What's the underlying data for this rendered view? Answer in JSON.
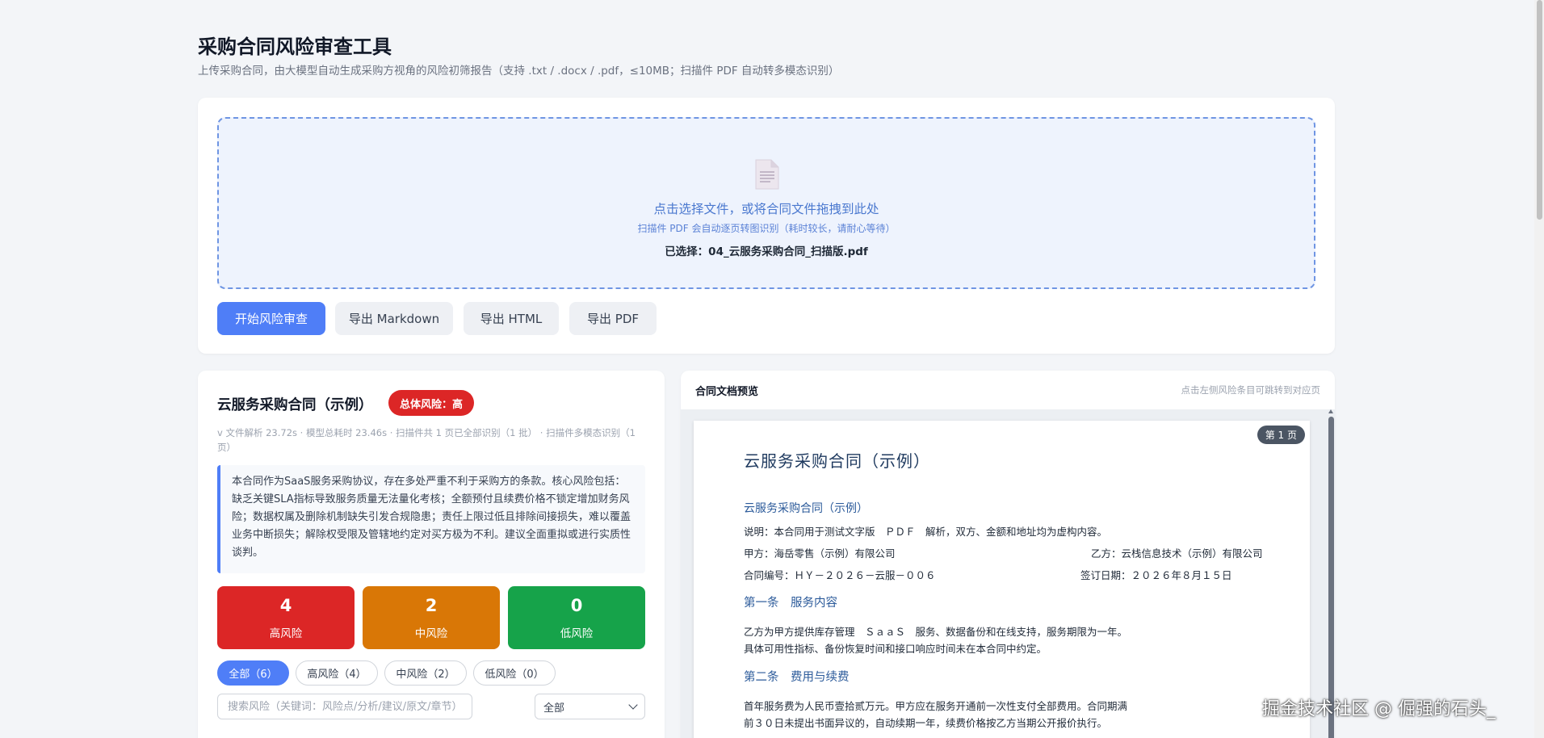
{
  "app": {
    "title": "采购合同风险审查工具",
    "subtitle": "上传采购合同，由大模型自动生成采购方视角的风险初筛报告（支持 .txt / .docx / .pdf，≤10MB；扫描件 PDF 自动转多模态识别）"
  },
  "upload": {
    "main_text": "点击选择文件，或将合同文件拖拽到此处",
    "hint_text": "扫描件 PDF 会自动逐页转图识别（耗时较长，请耐心等待）",
    "selected_text": "已选择：04_云服务采购合同_扫描版.pdf"
  },
  "toolbar": {
    "start_label": "开始风险审查",
    "export_md_label": "导出 Markdown",
    "export_html_label": "导出 HTML",
    "export_pdf_label": "导出 PDF"
  },
  "report": {
    "title": "云服务采购合同（示例）",
    "overall_risk": "总体风险：高",
    "meta": "v 文件解析 23.72s · 模型总耗时 23.46s · 扫描件共 1 页已全部识别（1 批） · 扫描件多模态识别（1 页）",
    "summary": "本合同作为SaaS服务采购协议，存在多处严重不利于采购方的条款。核心风险包括：缺乏关键SLA指标导致服务质量无法量化考核；全额预付且续费价格不锁定增加财务风险；数据权属及删除机制缺失引发合规隐患；责任上限过低且排除间接损失，难以覆盖业务中断损失；解除权受限及管辖地约定对买方极为不利。建议全面重拟或进行实质性谈判。",
    "stats": {
      "high_count": "4",
      "high_label": "高风险",
      "mid_count": "2",
      "mid_label": "中风险",
      "low_count": "0",
      "low_label": "低风险"
    },
    "filters": {
      "all": "全部（6）",
      "high": "高风险（4）",
      "mid": "中风险（2）",
      "low": "低风险（0）"
    },
    "search_placeholder": "搜索风险（关键词：风险点/分析/建议/原文/章节）",
    "select_value": "全部"
  },
  "preview": {
    "title": "合同文档预览",
    "hint": "点击左侧风险条目可跳转到对应页",
    "page_badge": "第 1 页",
    "doc_title": "云服务采购合同（示例）",
    "doc_subtitle": "云服务采购合同（示例）",
    "line1": "说明：本合同用于测试文字版　ＰＤＦ　解析，双方、金额和地址均为虚构内容。",
    "line2_a": "甲方：海岳零售（示例）有限公司",
    "line2_b": "乙方：云栈信息技术（示例）有限公司",
    "line3_a": "合同编号：ＨＹ－２０２６－云服－００６",
    "line3_b": "签订日期：２０２６年８月１５日",
    "section1": "第一条　服务内容",
    "s1_line1": "乙方为甲方提供库存管理　ＳａａＳ　服务、数据备份和在线支持，服务期限为一年。",
    "s1_line2": "具体可用性指标、备份恢复时间和接口响应时间未在本合同中约定。",
    "section2": "第二条　费用与续费",
    "s2_line1": "首年服务费为人民币壹拾贰万元。甲方应在服务开通前一次性支付全部费用。合同期满",
    "s2_line2": "前３０日未提出书面异议的，自动续期一年，续费价格按乙方当期公开报价执行。"
  },
  "watermark": "掘金技术社区 @ 倔强的石头_",
  "colors": {
    "accent": "#4f7ef7",
    "high": "#dc2626",
    "mid": "#d97706",
    "low": "#16a34a"
  }
}
